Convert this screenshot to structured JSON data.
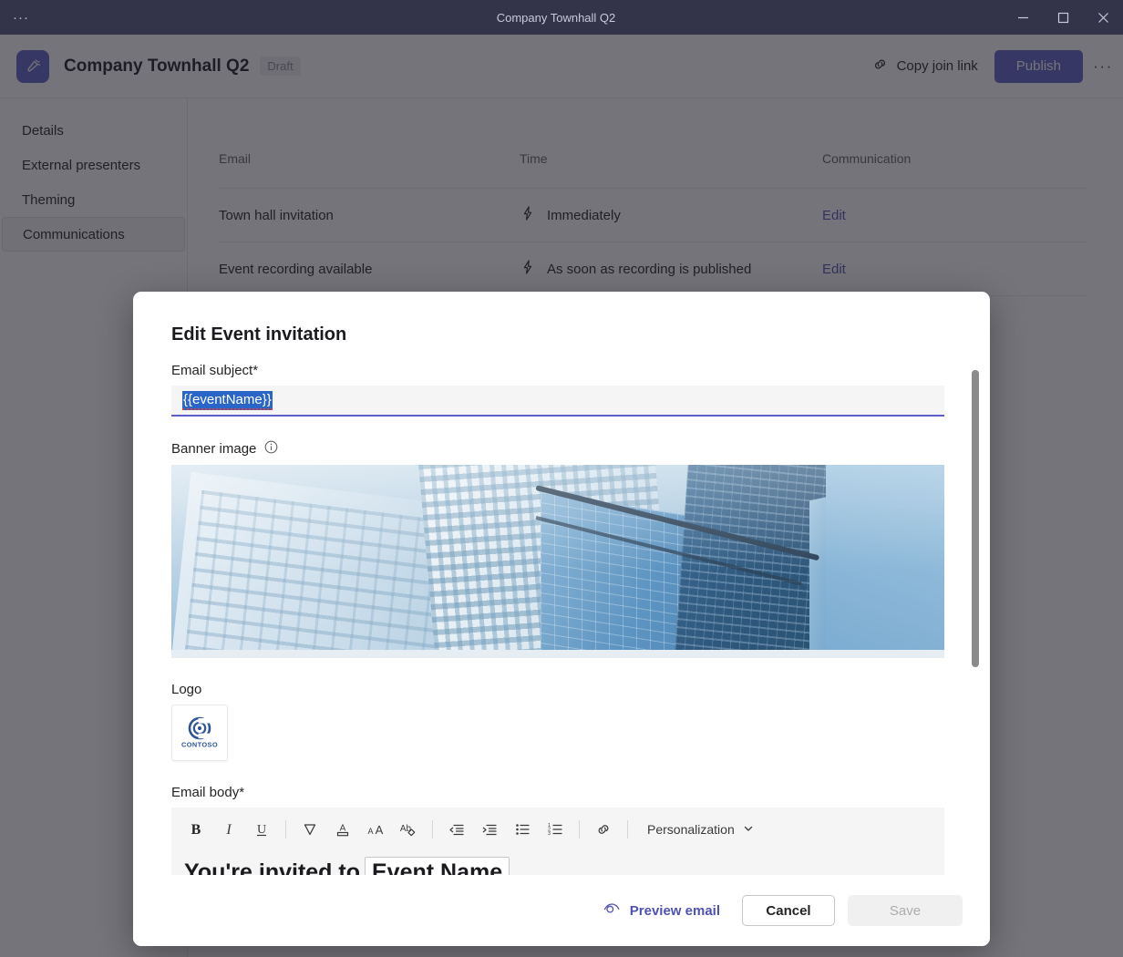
{
  "window": {
    "menu_glyph": "···",
    "title": "Company Townhall Q2",
    "minimize": "minimize-icon",
    "maximize": "maximize-icon",
    "close": "close-icon"
  },
  "header": {
    "app_icon": "megaphone-icon",
    "title": "Company Townhall Q2",
    "status_badge": "Draft",
    "copy_join_link": "Copy join link",
    "link_icon": "link-icon",
    "publish": "Publish",
    "more_glyph": "···",
    "accent": "#5b5fc7"
  },
  "sidebar": {
    "items": [
      {
        "label": "Details",
        "active": false
      },
      {
        "label": "External presenters",
        "active": false
      },
      {
        "label": "Theming",
        "active": false
      },
      {
        "label": "Communications",
        "active": true
      }
    ]
  },
  "table": {
    "columns": [
      "Email",
      "Time",
      "Communication"
    ],
    "rows": [
      {
        "email": "Town hall invitation",
        "time_icon": "lightning-bolt-icon",
        "time": "Immediately",
        "action": "Edit"
      },
      {
        "email": "Event recording available",
        "time_icon": "lightning-bolt-icon",
        "time": "As soon as recording is published",
        "action": "Edit"
      }
    ]
  },
  "modal": {
    "title": "Edit Event invitation",
    "subject": {
      "label": "Email subject*",
      "value": "{{eventName}}",
      "selected": true,
      "selection_color": "#2a66c8"
    },
    "banner": {
      "label": "Banner image",
      "info_icon": "info-icon",
      "alt": "Glass office towers photographed from below"
    },
    "logo": {
      "label": "Logo",
      "brand": "CONTOSO",
      "mark_color": "#2f5597"
    },
    "body": {
      "label": "Email body*",
      "toolbar": [
        {
          "name": "bold-icon",
          "label": "B"
        },
        {
          "name": "italic-icon",
          "label": "I"
        },
        {
          "name": "underline-icon",
          "label": "U"
        },
        {
          "name": "highlight-icon",
          "label": ""
        },
        {
          "name": "font-color-icon",
          "label": "A"
        },
        {
          "name": "font-size-icon",
          "label": "AA"
        },
        {
          "name": "clear-formatting-icon",
          "label": "Ab"
        },
        {
          "name": "decrease-indent-icon",
          "label": ""
        },
        {
          "name": "increase-indent-icon",
          "label": ""
        },
        {
          "name": "bulleted-list-icon",
          "label": ""
        },
        {
          "name": "numbered-list-icon",
          "label": ""
        },
        {
          "name": "link-icon",
          "label": ""
        }
      ],
      "personalization": "Personalization",
      "personalization_chevron": "chevron-down-icon",
      "content_prefix": "You're invited to",
      "content_token": "Event Name"
    },
    "footer": {
      "preview_icon": "eye-icon",
      "preview": "Preview email",
      "cancel": "Cancel",
      "save": "Save",
      "save_disabled": true
    },
    "scrollbar": {
      "name": "modal-scrollbar"
    }
  }
}
